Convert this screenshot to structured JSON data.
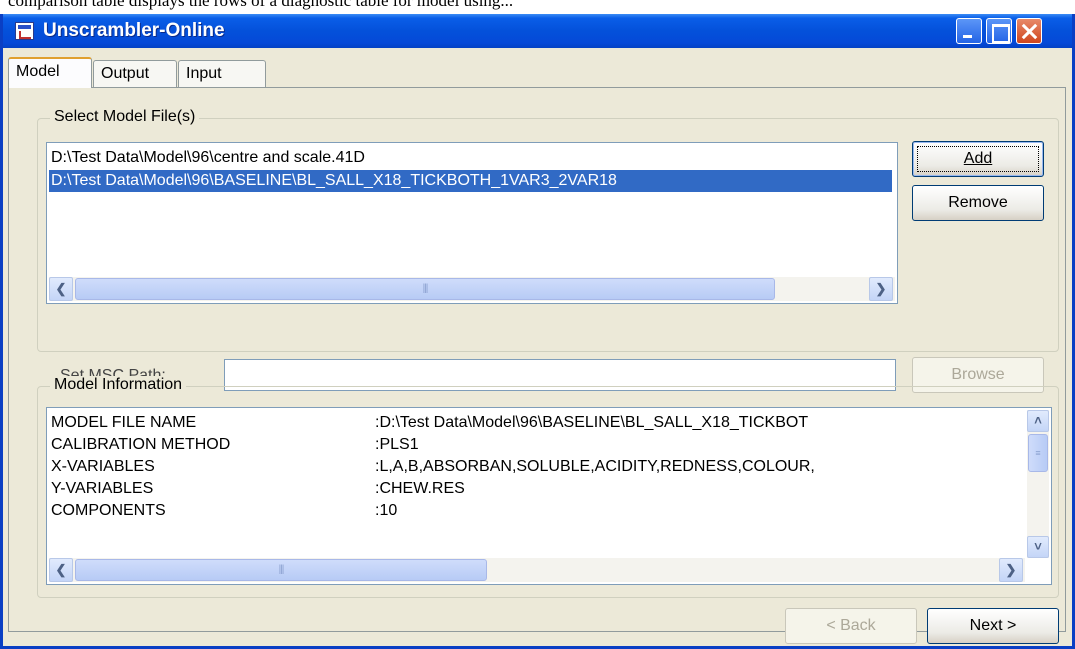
{
  "top_strip_text": "comparison table displays the rows of a diagnostic table for model using...",
  "window": {
    "title": "Unscrambler-Online"
  },
  "tabs": [
    {
      "label": "Model",
      "active": true
    },
    {
      "label": "Output",
      "active": false
    },
    {
      "label": "Input",
      "active": false
    }
  ],
  "select_group": {
    "label": "Select Model File(s)",
    "files": [
      {
        "path": "D:\\Test Data\\Model\\96\\centre and scale.41D",
        "selected": false
      },
      {
        "path": "D:\\Test Data\\Model\\96\\BASELINE\\BL_SALL_X18_TICKBOTH_1VAR3_2VAR18",
        "selected": true
      }
    ],
    "add_label": "Add",
    "remove_label": "Remove",
    "msc_label": "Set MSC Path:",
    "msc_value": "",
    "browse_label": "Browse"
  },
  "info_group": {
    "label": "Model Information",
    "rows": [
      {
        "key": "MODEL FILE NAME",
        "value": ":D:\\Test Data\\Model\\96\\BASELINE\\BL_SALL_X18_TICKBOT"
      },
      {
        "key": "CALIBRATION METHOD",
        "value": ":PLS1"
      },
      {
        "key": "X-VARIABLES",
        "value": ":L,A,B,ABSORBAN,SOLUBLE,ACIDITY,REDNESS,COLOUR,"
      },
      {
        "key": "Y-VARIABLES",
        "value": ":CHEW.RES"
      },
      {
        "key": "COMPONENTS",
        "value": ":10"
      }
    ]
  },
  "footer": {
    "back_label": "< Back",
    "next_label": "Next >"
  },
  "colors": {
    "title_bar": "#0451da",
    "selection": "#316ac5",
    "dialog_bg": "#ece9d8"
  },
  "icons": [
    "app-icon",
    "minimize-icon",
    "maximize-icon",
    "close-icon",
    "scroll-left-arrow-icon",
    "scroll-right-arrow-icon",
    "scroll-up-arrow-icon",
    "scroll-down-arrow-icon"
  ]
}
